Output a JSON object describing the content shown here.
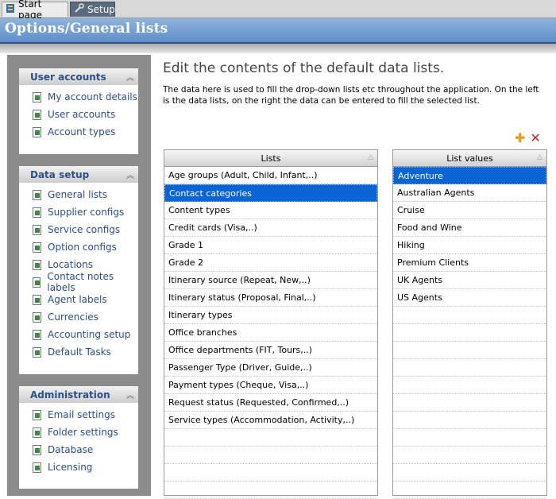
{
  "tabs": [
    {
      "label": "Start page",
      "icon": "start-page-icon"
    },
    {
      "label": "Setup",
      "icon": "wrench-icon"
    }
  ],
  "header": {
    "title": "Options/General lists"
  },
  "sidebar": {
    "sections": [
      {
        "title": "User accounts",
        "items": [
          {
            "label": "My account details"
          },
          {
            "label": "User accounts"
          },
          {
            "label": "Account types"
          }
        ]
      },
      {
        "title": "Data setup",
        "items": [
          {
            "label": "General lists"
          },
          {
            "label": "Supplier configs"
          },
          {
            "label": "Service configs"
          },
          {
            "label": "Option configs"
          },
          {
            "label": "Locations"
          },
          {
            "label": "Contact notes labels"
          },
          {
            "label": "Agent labels"
          },
          {
            "label": "Currencies"
          },
          {
            "label": "Accounting setup"
          },
          {
            "label": "Default Tasks"
          }
        ]
      },
      {
        "title": "Administration",
        "items": [
          {
            "label": "Email settings"
          },
          {
            "label": "Folder settings"
          },
          {
            "label": "Database"
          },
          {
            "label": "Licensing"
          }
        ]
      }
    ]
  },
  "main": {
    "title": "Edit the contents of the default data lists.",
    "description": "The data here is used to fill the drop-down lists etc throughout the application. On the left is the data lists, on the right the data can be entered to fill the selected list.",
    "lists": {
      "header": "Lists",
      "selected_index": 1,
      "items": [
        "Age groups (Adult, Child, Infant,..)",
        "Contact categories",
        "Content types",
        "Credit cards (Visa,..)",
        "Grade 1",
        "Grade 2",
        "Itinerary source (Repeat, New,..)",
        "Itinerary status (Proposal, Final,..)",
        "Itinerary types",
        "Office branches",
        "Office departments (FIT, Tours,..)",
        "Passenger Type (Driver, Guide,..)",
        "Payment types (Cheque, Visa,..)",
        "Request status (Requested, Confirmed,..)",
        "Service types (Accommodation, Activity,..)"
      ]
    },
    "values": {
      "header": "List values",
      "selected_index": 0,
      "items": [
        "Adventure",
        "Australian Agents",
        "Cruise",
        "Food and Wine",
        "Hiking",
        "Premium Clients",
        "UK Agents",
        "US Agents"
      ]
    },
    "toolbar": {
      "add_icon": "add-icon",
      "delete_icon": "delete-icon"
    }
  },
  "colors": {
    "selection": "#0a64d4",
    "link": "#2b4d8d",
    "titlebar": "#5f8ec7"
  }
}
